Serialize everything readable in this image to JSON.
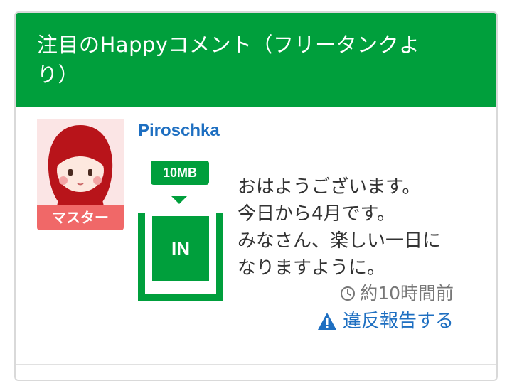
{
  "header": {
    "title_line1": "注目のHappyコメント（フリータンクよ",
    "title_line2": "り）"
  },
  "post": {
    "user": {
      "avatar_icon": "hooded-girl-avatar-icon",
      "name": "Piroschka",
      "role": "マスター"
    },
    "tank": {
      "size": "10MB",
      "status": "IN"
    },
    "message_lines": [
      "おはようございます。",
      "今日から4月です。",
      "みなさん、楽しい一日に",
      "なりますように。"
    ],
    "time": "約10時間前",
    "time_icon": "clock-icon",
    "report_label": "違反報告する",
    "report_icon": "warning-icon"
  },
  "colors": {
    "brand_green": "#009f3c",
    "link_blue": "#1e6fc1",
    "badge_red": "#f06868"
  }
}
